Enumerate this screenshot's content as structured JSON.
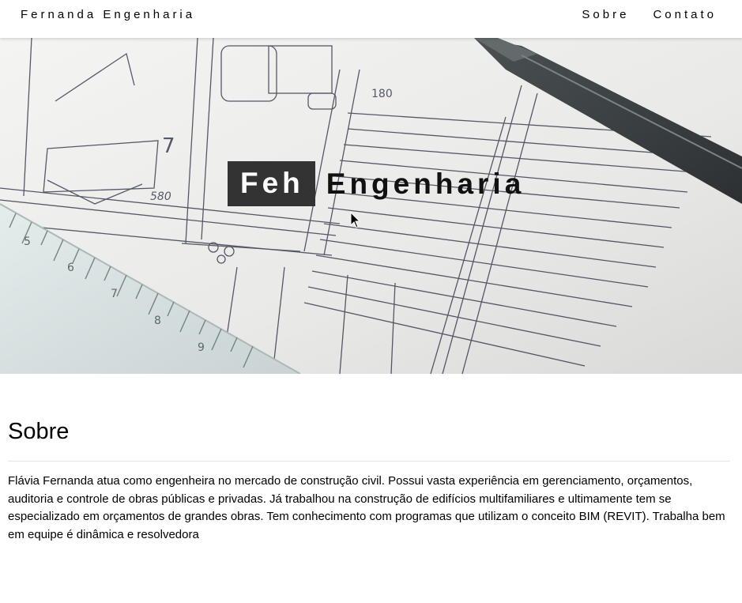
{
  "header": {
    "brand": "Fernanda Engenharia",
    "nav": [
      {
        "label": "Sobre"
      },
      {
        "label": "Contato"
      }
    ]
  },
  "hero": {
    "title_highlight": "Feh",
    "title_rest": "Engenharia"
  },
  "about": {
    "heading": "Sobre",
    "text": "Flávia Fernanda atua como engenheira no mercado de construção civil. Possui vasta experiência em gerenciamento, orçamentos, auditoria e controle de obras públicas e privadas. Já trabalhou na construção de edifícios multifamiliares e ultimamente tem se especializado em orçamentos de grandes obras. Tem conhecimento com programas que utilizam o conceito BIM (REVIT). Trabalha bem em equipe é dinâmica e resolvedora"
  },
  "colors": {
    "hero_box": "#333333",
    "divider": "#e5e5e5"
  }
}
